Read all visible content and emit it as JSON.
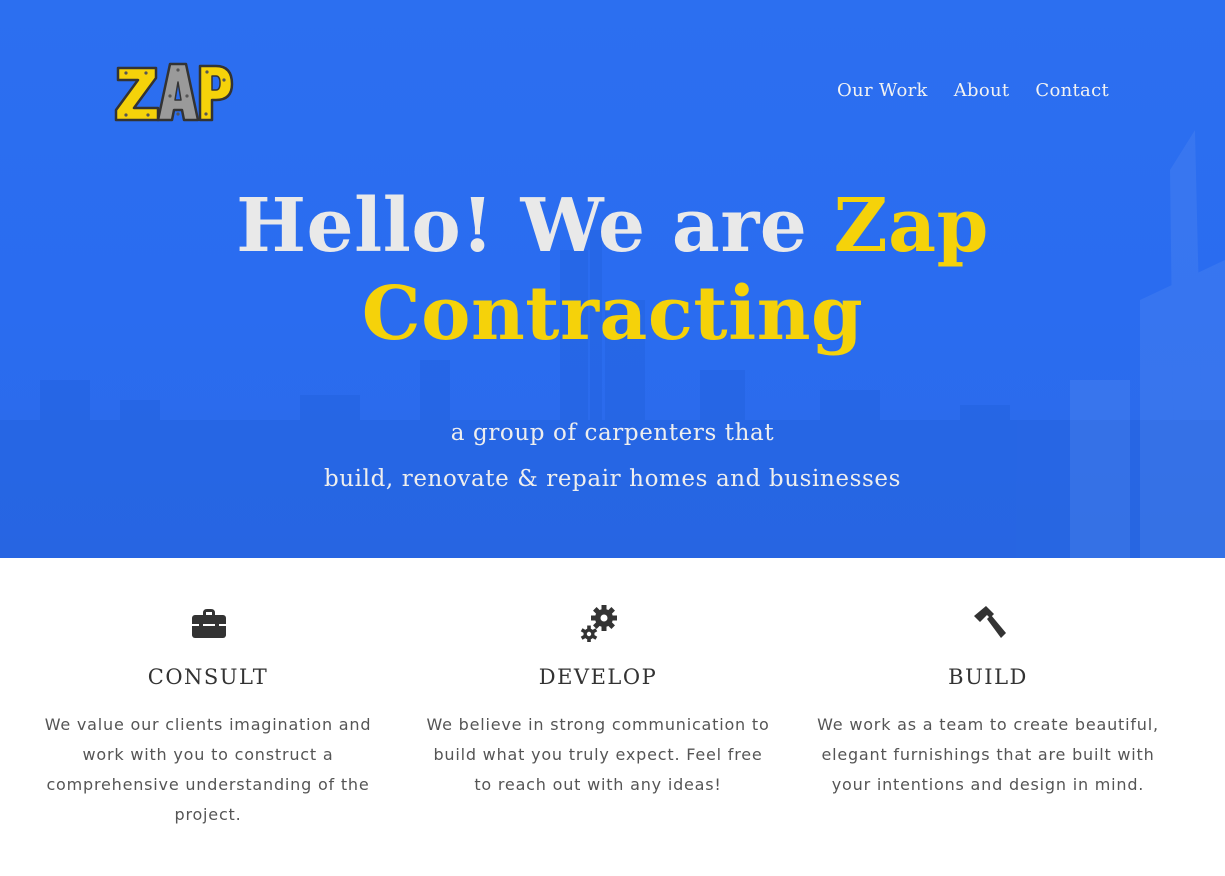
{
  "brand": {
    "logo_text": "ZAP",
    "accent_color": "#f5d20a",
    "hero_color": "#2a6cf0"
  },
  "nav": {
    "items": [
      {
        "label": "Our Work"
      },
      {
        "label": "About"
      },
      {
        "label": "Contact"
      }
    ]
  },
  "hero": {
    "title_plain": "Hello! We are ",
    "title_accent_1": "Zap",
    "title_accent_2": "Contracting",
    "subtitle_line_1": "a group of carpenters that",
    "subtitle_line_2": "build, renovate & repair homes and businesses"
  },
  "services": [
    {
      "icon": "briefcase-icon",
      "title": "CONSULT",
      "text": "We value our clients imagination and work with you to construct a comprehensive understanding of the project."
    },
    {
      "icon": "gears-icon",
      "title": "DEVELOP",
      "text": "We believe in strong communication to build what you truly expect. Feel free to reach out with any ideas!"
    },
    {
      "icon": "hammer-icon",
      "title": "BUILD",
      "text": "We work as a team to create beautiful, elegant furnishings that are built with your intentions and design in mind."
    }
  ]
}
